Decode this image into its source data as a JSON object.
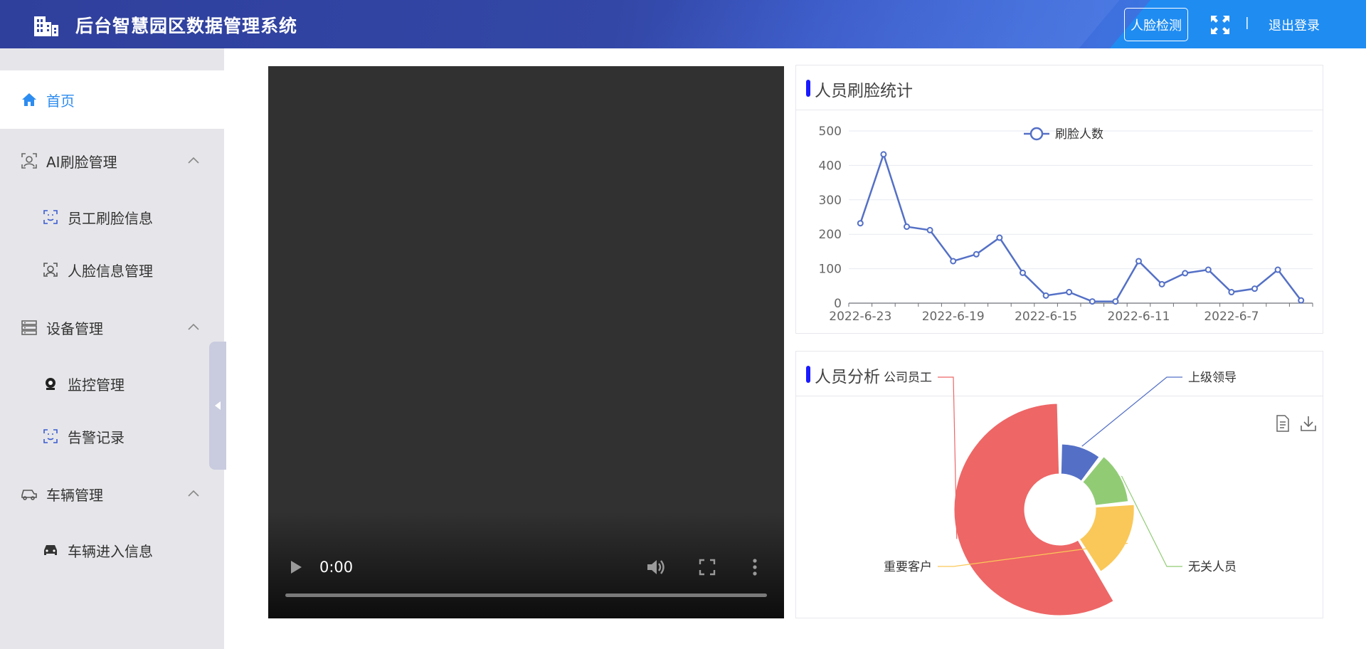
{
  "header": {
    "app_title": "后台智慧园区数据管理系统",
    "face_detect_button": "人脸检测",
    "separator": "|",
    "logout_label": "退出登录"
  },
  "sidebar": {
    "items": [
      {
        "label": "首页",
        "icon": "home-icon",
        "active": true
      },
      {
        "label": "AI刷脸管理",
        "icon": "face-scan-icon",
        "expanded": true,
        "children": [
          {
            "label": "员工刷脸信息",
            "icon": "face-frame-icon"
          },
          {
            "label": "人脸信息管理",
            "icon": "face-id-icon"
          }
        ]
      },
      {
        "label": "设备管理",
        "icon": "device-list-icon",
        "expanded": true,
        "children": [
          {
            "label": "监控管理",
            "icon": "camera-icon"
          },
          {
            "label": "告警记录",
            "icon": "alarm-frame-icon"
          }
        ]
      },
      {
        "label": "车辆管理",
        "icon": "car-icon",
        "expanded": true,
        "children": [
          {
            "label": "车辆进入信息",
            "icon": "car-front-icon"
          }
        ]
      }
    ]
  },
  "video": {
    "time": "0:00",
    "progress": 0
  },
  "face_stats_panel": {
    "title": "人员刷脸统计"
  },
  "analysis_panel": {
    "title": "人员分析"
  },
  "colors": {
    "accent": "#2d8cf0",
    "line_series": "#5470c6",
    "title_bar": "#1a1aff"
  },
  "chart_data": [
    {
      "type": "line",
      "legend": [
        "刷脸人数"
      ],
      "legend_position": "top-center",
      "x_tick_labels": [
        "2022-6-23",
        "2022-6-19",
        "2022-6-15",
        "2022-6-11",
        "2022-6-7"
      ],
      "ylim": [
        0,
        500
      ],
      "y_ticks": [
        0,
        100,
        200,
        300,
        400,
        500
      ],
      "grid": true,
      "series": [
        {
          "name": "刷脸人数",
          "values": [
            232,
            432,
            222,
            212,
            122,
            142,
            190,
            88,
            22,
            32,
            5,
            5,
            122,
            55,
            87,
            97,
            32,
            42,
            97,
            8
          ]
        }
      ]
    },
    {
      "type": "pie",
      "subtype": "nightingale-rose",
      "labels": [
        "公司员工",
        "上级领导",
        "无关人员",
        "重要客户"
      ],
      "values": [
        100,
        18,
        22,
        30
      ],
      "colors": [
        "#ee6666",
        "#5470c6",
        "#91cc75",
        "#fac858"
      ]
    }
  ]
}
